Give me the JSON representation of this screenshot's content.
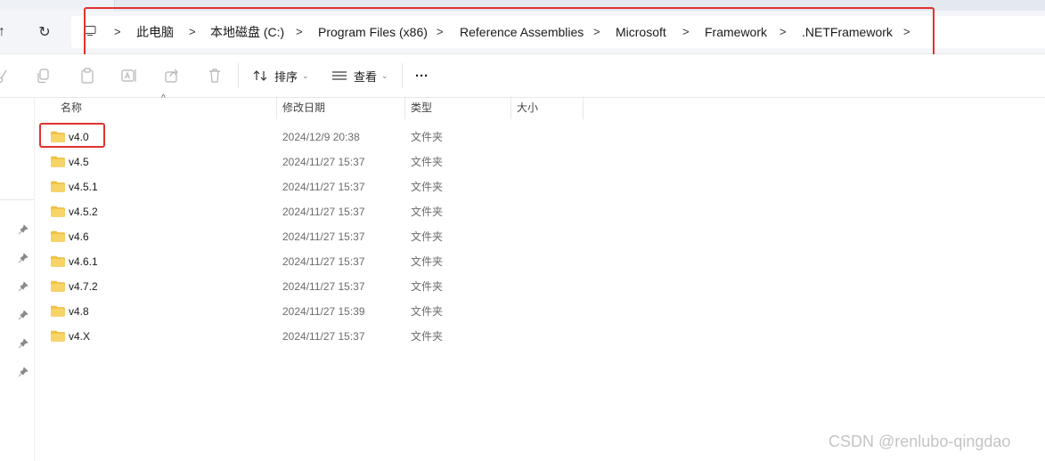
{
  "breadcrumb": {
    "items": [
      "此电脑",
      "本地磁盘 (C:)",
      "Program Files (x86)",
      "Reference Assemblies",
      "Microsoft",
      "Framework",
      ".NETFramework"
    ],
    "separator": ">"
  },
  "toolbar": {
    "sort_label": "排序",
    "view_label": "查看",
    "more_label": "···"
  },
  "columns": {
    "name": "名称",
    "modified": "修改日期",
    "type": "类型",
    "size": "大小"
  },
  "files": [
    {
      "name": "v4.0",
      "modified": "2024/12/9 20:38",
      "type": "文件夹"
    },
    {
      "name": "v4.5",
      "modified": "2024/11/27 15:37",
      "type": "文件夹"
    },
    {
      "name": "v4.5.1",
      "modified": "2024/11/27 15:37",
      "type": "文件夹"
    },
    {
      "name": "v4.5.2",
      "modified": "2024/11/27 15:37",
      "type": "文件夹"
    },
    {
      "name": "v4.6",
      "modified": "2024/11/27 15:37",
      "type": "文件夹"
    },
    {
      "name": "v4.6.1",
      "modified": "2024/11/27 15:37",
      "type": "文件夹"
    },
    {
      "name": "v4.7.2",
      "modified": "2024/11/27 15:37",
      "type": "文件夹"
    },
    {
      "name": "v4.8",
      "modified": "2024/11/27 15:39",
      "type": "文件夹"
    },
    {
      "name": "v4.X",
      "modified": "2024/11/27 15:37",
      "type": "文件夹"
    }
  ],
  "watermark": "CSDN @renlubo-qingdao",
  "colors": {
    "highlight_red": "#e0322e",
    "folder_yellow": "#f4c542"
  }
}
